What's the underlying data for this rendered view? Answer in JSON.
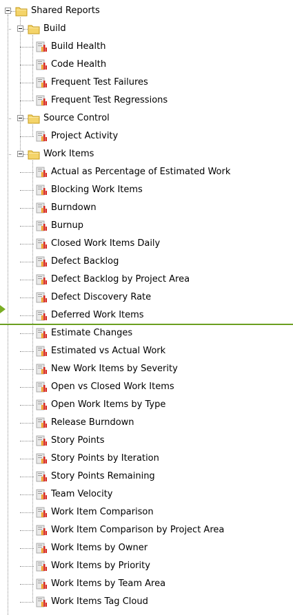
{
  "tree": {
    "root": {
      "label": "Shared Reports",
      "icon": "folder-icon",
      "expanded": true,
      "children": [
        {
          "label": "Build",
          "icon": "folder-icon",
          "expanded": true,
          "children": [
            {
              "label": "Build Health",
              "icon": "report-icon"
            },
            {
              "label": "Code Health",
              "icon": "report-icon"
            },
            {
              "label": "Frequent Test Failures",
              "icon": "report-icon"
            },
            {
              "label": "Frequent Test Regressions",
              "icon": "report-icon"
            }
          ]
        },
        {
          "label": "Source Control",
          "icon": "folder-icon",
          "expanded": true,
          "children": [
            {
              "label": "Project Activity",
              "icon": "report-icon"
            }
          ]
        },
        {
          "label": "Work Items",
          "icon": "folder-icon",
          "expanded": true,
          "children": [
            {
              "label": "Actual as Percentage of Estimated Work",
              "icon": "report-icon"
            },
            {
              "label": "Blocking Work Items",
              "icon": "report-icon"
            },
            {
              "label": "Burndown",
              "icon": "report-icon"
            },
            {
              "label": "Burnup",
              "icon": "report-icon"
            },
            {
              "label": "Closed Work Items Daily",
              "icon": "report-icon"
            },
            {
              "label": "Defect Backlog",
              "icon": "report-icon"
            },
            {
              "label": "Defect Backlog by Project Area",
              "icon": "report-icon"
            },
            {
              "label": "Defect Discovery Rate",
              "icon": "report-icon"
            },
            {
              "label": "Deferred Work Items",
              "icon": "report-icon"
            },
            {
              "label": "Estimate Changes",
              "icon": "report-icon"
            },
            {
              "label": "Estimated vs Actual Work",
              "icon": "report-icon"
            },
            {
              "label": "New Work Items by Severity",
              "icon": "report-icon"
            },
            {
              "label": "Open vs Closed Work Items",
              "icon": "report-icon"
            },
            {
              "label": "Open Work Items by Type",
              "icon": "report-icon"
            },
            {
              "label": "Release Burndown",
              "icon": "report-icon"
            },
            {
              "label": "Story Points",
              "icon": "report-icon"
            },
            {
              "label": "Story Points by Iteration",
              "icon": "report-icon"
            },
            {
              "label": "Story Points Remaining",
              "icon": "report-icon"
            },
            {
              "label": "Team Velocity",
              "icon": "report-icon"
            },
            {
              "label": "Work Item Comparison",
              "icon": "report-icon"
            },
            {
              "label": "Work Item Comparison by Project Area",
              "icon": "report-icon"
            },
            {
              "label": "Work Items by Owner",
              "icon": "report-icon"
            },
            {
              "label": "Work Items by Priority",
              "icon": "report-icon"
            },
            {
              "label": "Work Items by Team Area",
              "icon": "report-icon"
            },
            {
              "label": "Work Items Tag Cloud",
              "icon": "report-icon"
            }
          ]
        }
      ]
    },
    "drop_indicator": {
      "after_item": "Deferred Work Items",
      "color": "#6a9e1f",
      "arrow_color": "#7aad24"
    }
  },
  "colors": {
    "folder_fill": "#f4d46a",
    "folder_outline": "#c49a1a",
    "report_page": "#e9e9e9",
    "report_bar_red": "#d7261e",
    "report_bar_orange": "#f0a020",
    "tree_lines": "#8e8e8e"
  }
}
